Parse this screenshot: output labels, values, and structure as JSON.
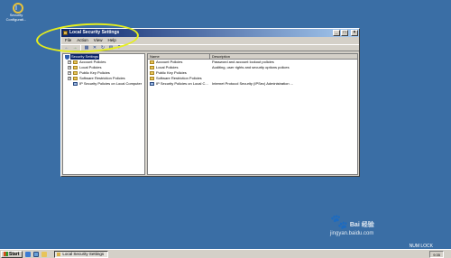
{
  "desktop": {
    "icon_label_line1": "Security",
    "icon_label_line2": "Configurati..."
  },
  "window": {
    "title": "Local Security Settings",
    "controls": {
      "minimize": "_",
      "maximize": "□",
      "close": "×"
    },
    "menu": [
      "File",
      "Action",
      "View",
      "Help"
    ]
  },
  "tree": {
    "root": "Security Settings",
    "items": [
      {
        "label": "Account Policies",
        "expander": "+"
      },
      {
        "label": "Local Policies",
        "expander": "+"
      },
      {
        "label": "Public Key Policies",
        "expander": "+"
      },
      {
        "label": "Software Restriction Policies",
        "expander": "+"
      },
      {
        "label": "IP Security Policies on Local Computer",
        "expander": ""
      }
    ]
  },
  "list": {
    "columns": {
      "name": "Name",
      "description": "Description"
    },
    "rows": [
      {
        "name": "Account Policies",
        "description": "Password and account lockout policies"
      },
      {
        "name": "Local Policies",
        "description": "Auditing, user rights and security options polices"
      },
      {
        "name": "Public Key Policies",
        "description": ""
      },
      {
        "name": "Software Restriction Policies",
        "description": ""
      },
      {
        "name": "IP Security Policies on Local C...",
        "description": "Internet Protocol Security (IPSec) Administration ..."
      }
    ]
  },
  "taskbar": {
    "start_label": "Start",
    "task_label": "Local Security Settings",
    "clock": "9:35",
    "numlock": "NUM LOCK"
  },
  "watermark": {
    "brand": "Bai",
    "brand_cn": "经验",
    "url": "jingyan.baidu.com"
  }
}
